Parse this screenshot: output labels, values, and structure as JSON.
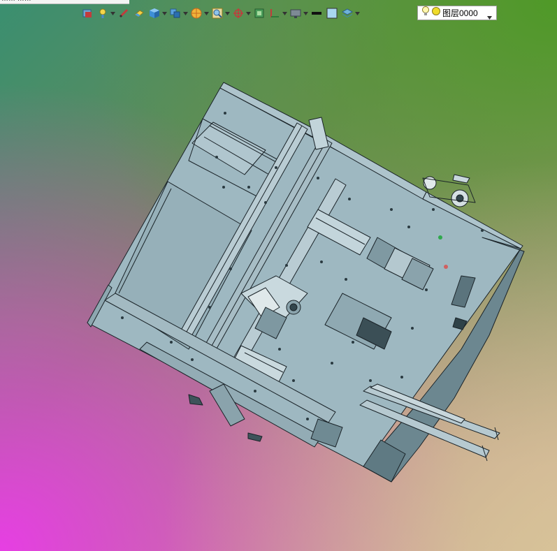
{
  "window": {
    "title_fragment": "…… ……"
  },
  "toolbar": {
    "buttons": [
      {
        "name": "save-view-icon",
        "has_menu": false
      },
      {
        "name": "light-icon",
        "has_menu": true
      },
      {
        "name": "pen-icon",
        "has_menu": false
      },
      {
        "name": "eraser-icon",
        "has_menu": false
      },
      {
        "name": "cube-icon",
        "has_menu": true
      },
      {
        "name": "view-cube-icon",
        "has_menu": true
      },
      {
        "name": "pie-section-icon",
        "has_menu": true
      },
      {
        "name": "zoom-icon",
        "has_menu": true
      },
      {
        "name": "rotate-axis-icon",
        "has_menu": true
      },
      {
        "name": "sketch-icon",
        "has_menu": false
      },
      {
        "name": "dimension-icon",
        "has_menu": true
      },
      {
        "name": "display-icon",
        "has_menu": true
      },
      {
        "name": "line-weight-icon",
        "has_menu": false
      },
      {
        "name": "color-swatch-icon",
        "has_menu": false
      },
      {
        "name": "layers-icon",
        "has_menu": true
      }
    ]
  },
  "layer": {
    "current": "图层0000"
  },
  "colors": {
    "accent_green": "#4c9a24",
    "accent_magenta": "#ec3aea",
    "model_fill": "#9eb8c1",
    "model_edge": "#1a2328"
  }
}
